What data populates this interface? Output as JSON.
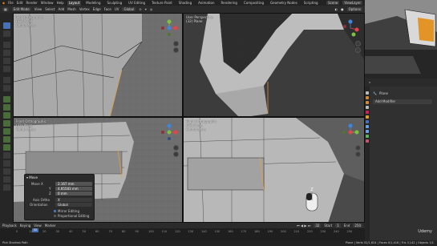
{
  "menu": {
    "items": [
      "File",
      "Edit",
      "Render",
      "Window",
      "Help"
    ],
    "workspaces": [
      "Layout",
      "Modeling",
      "Sculpting",
      "UV Editing",
      "Texture Paint",
      "Shading",
      "Animation",
      "Rendering",
      "Compositing",
      "Geometry Nodes",
      "Scripting"
    ],
    "active_workspace": "Layout",
    "scene": "Scene",
    "view_layer": "ViewLayer"
  },
  "header": {
    "mode": "Edit Mode",
    "menus": [
      "View",
      "Select",
      "Add",
      "Mesh",
      "Vertex",
      "Edge",
      "Face",
      "UV"
    ],
    "orientation": "Global",
    "options_label": "Options"
  },
  "viewports": {
    "top_left": {
      "line1": "Top Orthographic",
      "line2": "(32) Plane",
      "line3": "Centimeters"
    },
    "top_right": {
      "line1": "User Perspective",
      "line2": "(32) Plane"
    },
    "bottom_left": {
      "line1": "Front Orthographic",
      "line2": "(32) Plane",
      "line3": "Centimeters"
    },
    "bottom_right": {
      "line1": "Right Orthographic",
      "line2": "(32) Plane",
      "line3": "Centimeters"
    }
  },
  "gizmo_axes": {
    "x": "X",
    "y": "Y",
    "z": "Z"
  },
  "colors": {
    "x_axis": "#e8424c",
    "y_axis": "#7cc23f",
    "z_axis": "#3e86e0",
    "active": "#4772b3",
    "selected_edge": "#f59e2f"
  },
  "operator_panel": {
    "title": "Move",
    "move_label": "Move X",
    "move_x": "2.167 mm",
    "move_y": "4.85583 mm",
    "move_z": "0 mm",
    "y_label": "Y",
    "z_label": "Z",
    "axis_ortho_label": "Axis Ortho",
    "axis_ortho_value": "X",
    "orientation_label": "Orientation",
    "orientation_value": "Global",
    "mirror_editing": "Mirror Editing",
    "proportional_editing": "Proportional Editing"
  },
  "properties": {
    "object_name": "Plane",
    "add_modifier": "Add Modifier"
  },
  "timeline": {
    "menus": [
      "Playback",
      "Keying",
      "View",
      "Marker"
    ],
    "ticks": [
      "0",
      "10",
      "20",
      "30",
      "40",
      "50",
      "60",
      "70",
      "80",
      "90",
      "100",
      "110",
      "120",
      "130",
      "140",
      "150",
      "160",
      "170",
      "180",
      "190",
      "200",
      "210",
      "220",
      "230",
      "240",
      "250"
    ],
    "current_frame": "32",
    "start_label": "Start",
    "start": "1",
    "end_label": "End",
    "end": "250"
  },
  "status": {
    "left": "Pick Shortest Path",
    "right": "Plane | Verts 52/1,624 | Faces 0/1,416 | Tris 3,142 | Objects 1/1"
  },
  "watermark": "Udemy"
}
